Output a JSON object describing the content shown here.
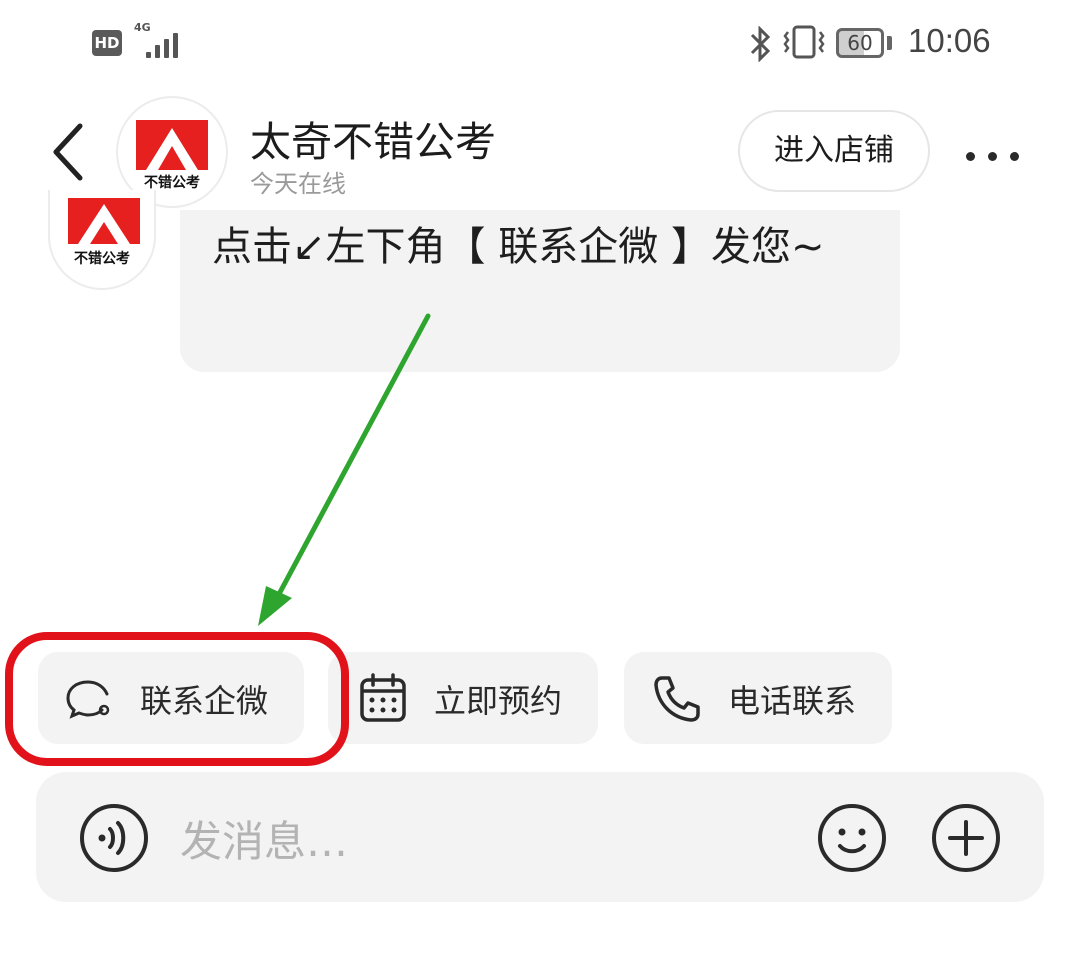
{
  "status_bar": {
    "hd_badge": "HD",
    "network_type": "4G",
    "battery_level": "60",
    "time": "10:06"
  },
  "header": {
    "shop_name": "太奇不错公考",
    "online_status": "今天在线",
    "enter_shop_label": "进入店铺",
    "avatar_logo_text": "不错公考"
  },
  "message": {
    "text": "点击↙左下角【 联系企微 】发您~",
    "avatar_logo_text": "不错公考"
  },
  "quick_actions": [
    {
      "label": "联系企微",
      "icon": "wechat-work-chat-icon"
    },
    {
      "label": "立即预约",
      "icon": "calendar-icon"
    },
    {
      "label": "电话联系",
      "icon": "phone-icon"
    }
  ],
  "input_bar": {
    "placeholder": "发消息…",
    "voice_icon": "voice-icon",
    "emoji_icon": "emoji-icon",
    "plus_icon": "plus-icon"
  },
  "colors": {
    "annotation_ring": "#e2121b",
    "annotation_arrow": "#2ea52e",
    "brand_red": "#e5201f"
  }
}
